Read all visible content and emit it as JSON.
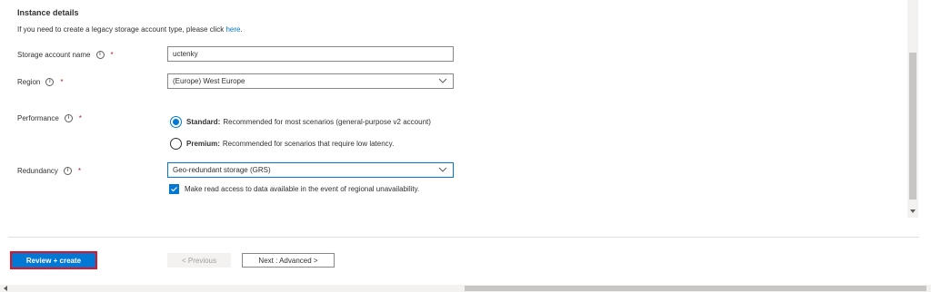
{
  "section": {
    "title": "Instance details",
    "legacy_text": "If you need to create a legacy storage account type, please click",
    "legacy_link": "here",
    "legacy_end": "."
  },
  "fields": {
    "storage_account_name": {
      "label": "Storage account name",
      "value": "uctenky"
    },
    "region": {
      "label": "Region",
      "value": "(Europe) West Europe"
    },
    "performance": {
      "label": "Performance",
      "options": [
        {
          "title": "Standard:",
          "desc": "Recommended for most scenarios (general-purpose v2 account)",
          "checked": true
        },
        {
          "title": "Premium:",
          "desc": "Recommended for scenarios that require low latency.",
          "checked": false
        }
      ]
    },
    "redundancy": {
      "label": "Redundancy",
      "value": "Geo-redundant storage (GRS)",
      "read_access_label": "Make read access to data available in the event of regional unavailability.",
      "read_access_checked": true
    }
  },
  "info_glyph": "i",
  "required_mark": "*",
  "footer": {
    "review_create": "Review + create",
    "previous": "< Previous",
    "next": "Next : Advanced >"
  },
  "colors": {
    "accent": "#0078d4",
    "highlight_border": "#e81123",
    "required": "#a4262c"
  },
  "icons": [
    "info-icon",
    "chevron-down-icon",
    "checkmark-icon",
    "scroll-arrow-down-icon",
    "scroll-arrow-left-icon"
  ]
}
